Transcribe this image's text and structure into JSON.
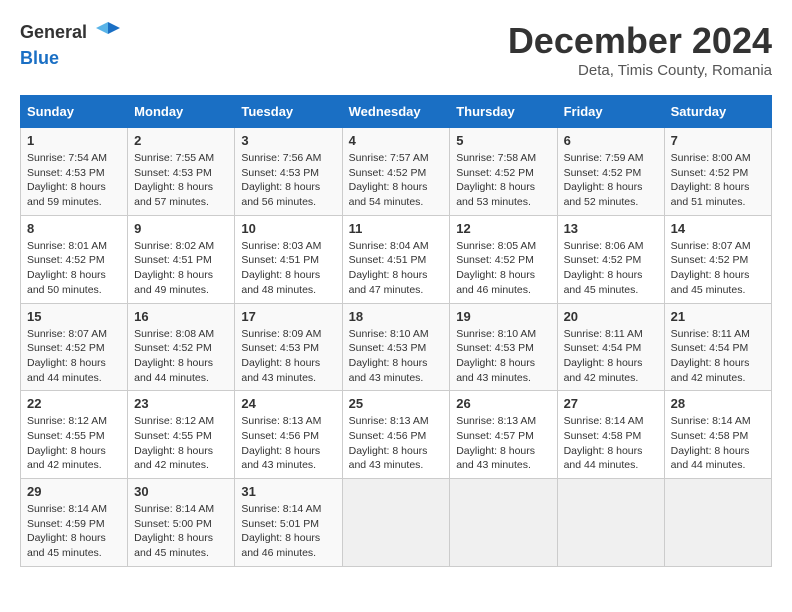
{
  "header": {
    "logo_general": "General",
    "logo_blue": "Blue",
    "month_title": "December 2024",
    "subtitle": "Deta, Timis County, Romania"
  },
  "weekdays": [
    "Sunday",
    "Monday",
    "Tuesday",
    "Wednesday",
    "Thursday",
    "Friday",
    "Saturday"
  ],
  "weeks": [
    [
      {
        "day": "1",
        "sunrise": "Sunrise: 7:54 AM",
        "sunset": "Sunset: 4:53 PM",
        "daylight": "Daylight: 8 hours and 59 minutes."
      },
      {
        "day": "2",
        "sunrise": "Sunrise: 7:55 AM",
        "sunset": "Sunset: 4:53 PM",
        "daylight": "Daylight: 8 hours and 57 minutes."
      },
      {
        "day": "3",
        "sunrise": "Sunrise: 7:56 AM",
        "sunset": "Sunset: 4:53 PM",
        "daylight": "Daylight: 8 hours and 56 minutes."
      },
      {
        "day": "4",
        "sunrise": "Sunrise: 7:57 AM",
        "sunset": "Sunset: 4:52 PM",
        "daylight": "Daylight: 8 hours and 54 minutes."
      },
      {
        "day": "5",
        "sunrise": "Sunrise: 7:58 AM",
        "sunset": "Sunset: 4:52 PM",
        "daylight": "Daylight: 8 hours and 53 minutes."
      },
      {
        "day": "6",
        "sunrise": "Sunrise: 7:59 AM",
        "sunset": "Sunset: 4:52 PM",
        "daylight": "Daylight: 8 hours and 52 minutes."
      },
      {
        "day": "7",
        "sunrise": "Sunrise: 8:00 AM",
        "sunset": "Sunset: 4:52 PM",
        "daylight": "Daylight: 8 hours and 51 minutes."
      }
    ],
    [
      {
        "day": "8",
        "sunrise": "Sunrise: 8:01 AM",
        "sunset": "Sunset: 4:52 PM",
        "daylight": "Daylight: 8 hours and 50 minutes."
      },
      {
        "day": "9",
        "sunrise": "Sunrise: 8:02 AM",
        "sunset": "Sunset: 4:51 PM",
        "daylight": "Daylight: 8 hours and 49 minutes."
      },
      {
        "day": "10",
        "sunrise": "Sunrise: 8:03 AM",
        "sunset": "Sunset: 4:51 PM",
        "daylight": "Daylight: 8 hours and 48 minutes."
      },
      {
        "day": "11",
        "sunrise": "Sunrise: 8:04 AM",
        "sunset": "Sunset: 4:51 PM",
        "daylight": "Daylight: 8 hours and 47 minutes."
      },
      {
        "day": "12",
        "sunrise": "Sunrise: 8:05 AM",
        "sunset": "Sunset: 4:52 PM",
        "daylight": "Daylight: 8 hours and 46 minutes."
      },
      {
        "day": "13",
        "sunrise": "Sunrise: 8:06 AM",
        "sunset": "Sunset: 4:52 PM",
        "daylight": "Daylight: 8 hours and 45 minutes."
      },
      {
        "day": "14",
        "sunrise": "Sunrise: 8:07 AM",
        "sunset": "Sunset: 4:52 PM",
        "daylight": "Daylight: 8 hours and 45 minutes."
      }
    ],
    [
      {
        "day": "15",
        "sunrise": "Sunrise: 8:07 AM",
        "sunset": "Sunset: 4:52 PM",
        "daylight": "Daylight: 8 hours and 44 minutes."
      },
      {
        "day": "16",
        "sunrise": "Sunrise: 8:08 AM",
        "sunset": "Sunset: 4:52 PM",
        "daylight": "Daylight: 8 hours and 44 minutes."
      },
      {
        "day": "17",
        "sunrise": "Sunrise: 8:09 AM",
        "sunset": "Sunset: 4:53 PM",
        "daylight": "Daylight: 8 hours and 43 minutes."
      },
      {
        "day": "18",
        "sunrise": "Sunrise: 8:10 AM",
        "sunset": "Sunset: 4:53 PM",
        "daylight": "Daylight: 8 hours and 43 minutes."
      },
      {
        "day": "19",
        "sunrise": "Sunrise: 8:10 AM",
        "sunset": "Sunset: 4:53 PM",
        "daylight": "Daylight: 8 hours and 43 minutes."
      },
      {
        "day": "20",
        "sunrise": "Sunrise: 8:11 AM",
        "sunset": "Sunset: 4:54 PM",
        "daylight": "Daylight: 8 hours and 42 minutes."
      },
      {
        "day": "21",
        "sunrise": "Sunrise: 8:11 AM",
        "sunset": "Sunset: 4:54 PM",
        "daylight": "Daylight: 8 hours and 42 minutes."
      }
    ],
    [
      {
        "day": "22",
        "sunrise": "Sunrise: 8:12 AM",
        "sunset": "Sunset: 4:55 PM",
        "daylight": "Daylight: 8 hours and 42 minutes."
      },
      {
        "day": "23",
        "sunrise": "Sunrise: 8:12 AM",
        "sunset": "Sunset: 4:55 PM",
        "daylight": "Daylight: 8 hours and 42 minutes."
      },
      {
        "day": "24",
        "sunrise": "Sunrise: 8:13 AM",
        "sunset": "Sunset: 4:56 PM",
        "daylight": "Daylight: 8 hours and 43 minutes."
      },
      {
        "day": "25",
        "sunrise": "Sunrise: 8:13 AM",
        "sunset": "Sunset: 4:56 PM",
        "daylight": "Daylight: 8 hours and 43 minutes."
      },
      {
        "day": "26",
        "sunrise": "Sunrise: 8:13 AM",
        "sunset": "Sunset: 4:57 PM",
        "daylight": "Daylight: 8 hours and 43 minutes."
      },
      {
        "day": "27",
        "sunrise": "Sunrise: 8:14 AM",
        "sunset": "Sunset: 4:58 PM",
        "daylight": "Daylight: 8 hours and 44 minutes."
      },
      {
        "day": "28",
        "sunrise": "Sunrise: 8:14 AM",
        "sunset": "Sunset: 4:58 PM",
        "daylight": "Daylight: 8 hours and 44 minutes."
      }
    ],
    [
      {
        "day": "29",
        "sunrise": "Sunrise: 8:14 AM",
        "sunset": "Sunset: 4:59 PM",
        "daylight": "Daylight: 8 hours and 45 minutes."
      },
      {
        "day": "30",
        "sunrise": "Sunrise: 8:14 AM",
        "sunset": "Sunset: 5:00 PM",
        "daylight": "Daylight: 8 hours and 45 minutes."
      },
      {
        "day": "31",
        "sunrise": "Sunrise: 8:14 AM",
        "sunset": "Sunset: 5:01 PM",
        "daylight": "Daylight: 8 hours and 46 minutes."
      },
      null,
      null,
      null,
      null
    ]
  ]
}
